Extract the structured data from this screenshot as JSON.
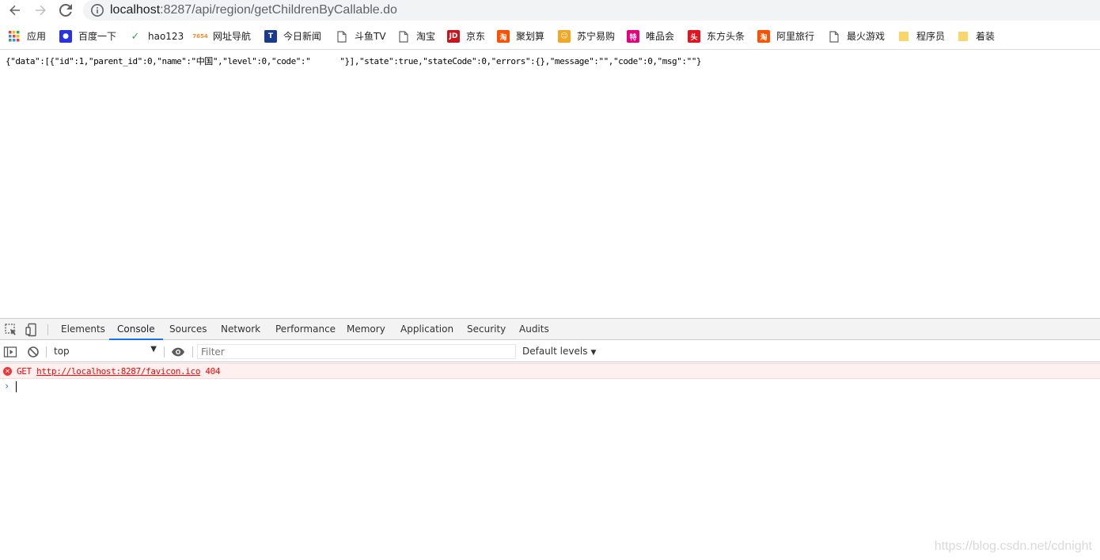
{
  "browser": {
    "url_host": "localhost",
    "url_rest": ":8287/api/region/getChildrenByCallable.do"
  },
  "bookmarks": [
    {
      "label": "应用",
      "icon": "apps-grid-icon",
      "color": "#1a73e8"
    },
    {
      "label": "百度一下",
      "icon": "baidu-paw-icon",
      "color": "#2932e1"
    },
    {
      "label": "hao123",
      "icon": "hao123-icon",
      "color": "#33a852"
    },
    {
      "label": "网址导航",
      "icon": "7654-icon",
      "color": "#f28b30"
    },
    {
      "label": "今日新闻",
      "icon": "news-t-icon",
      "color": "#1c3a8a"
    },
    {
      "label": "斗鱼TV",
      "icon": "page-icon",
      "color": "#5f6368"
    },
    {
      "label": "淘宝",
      "icon": "page-icon",
      "color": "#5f6368"
    },
    {
      "label": "京东",
      "icon": "jd-icon",
      "color": "#c9151e"
    },
    {
      "label": "聚划算",
      "icon": "taobao-icon",
      "color": "#ff5000"
    },
    {
      "label": "苏宁易购",
      "icon": "suning-lion-icon",
      "color": "#f5a623"
    },
    {
      "label": "唯品会",
      "icon": "vip-te-icon",
      "color": "#e4007f"
    },
    {
      "label": "东方头条",
      "icon": "toutiao-icon",
      "color": "#e5131d"
    },
    {
      "label": "阿里旅行",
      "icon": "taobao-icon",
      "color": "#ff5000"
    },
    {
      "label": "最火游戏",
      "icon": "page-icon",
      "color": "#5f6368"
    },
    {
      "label": "程序员",
      "icon": "folder-icon",
      "color": "#f9d66a"
    },
    {
      "label": "着装",
      "icon": "folder-icon",
      "color": "#f9d66a"
    }
  ],
  "page": {
    "json_text": "{\"data\":[{\"id\":1,\"parent_id\":0,\"name\":\"中国\",\"level\":0,\"code\":\"      \"}],\"state\":true,\"stateCode\":0,\"errors\":{},\"message\":\"\",\"code\":0,\"msg\":\"\"}"
  },
  "devtools": {
    "tabs": [
      "Elements",
      "Console",
      "Sources",
      "Network",
      "Performance",
      "Memory",
      "Application",
      "Security",
      "Audits"
    ],
    "active_tab": "Console",
    "context": "top",
    "filter_placeholder": "Filter",
    "levels_label": "Default levels",
    "error": {
      "method": "GET",
      "url": "http://localhost:8287/favicon.ico",
      "status": "404"
    },
    "prompt_symbol": "›"
  },
  "watermark": "https://blog.csdn.net/cdnight"
}
